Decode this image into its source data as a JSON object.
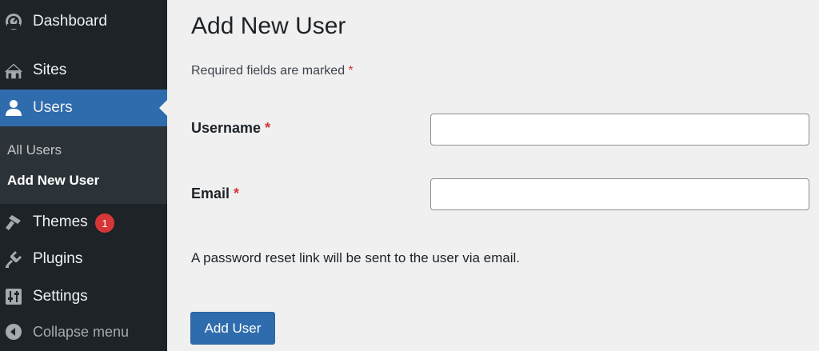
{
  "sidebar": {
    "items": [
      {
        "key": "dashboard",
        "label": "Dashboard",
        "icon": "dashboard-gauge-icon"
      },
      {
        "key": "sites",
        "label": "Sites",
        "icon": "sites-houses-icon"
      },
      {
        "key": "users",
        "label": "Users",
        "icon": "user-icon",
        "active": true
      },
      {
        "key": "themes",
        "label": "Themes",
        "icon": "brush-icon",
        "badge": "1"
      },
      {
        "key": "plugins",
        "label": "Plugins",
        "icon": "plug-icon"
      },
      {
        "key": "settings",
        "label": "Settings",
        "icon": "sliders-icon"
      },
      {
        "key": "collapse",
        "label": "Collapse menu",
        "icon": "collapse-arrow-icon"
      }
    ],
    "submenu": [
      {
        "label": "All Users"
      },
      {
        "label": "Add New User",
        "current": true
      }
    ]
  },
  "main": {
    "title": "Add New User",
    "required_note": "Required fields are marked",
    "required_marker": "*",
    "fields": [
      {
        "label": "Username",
        "value": "",
        "placeholder": ""
      },
      {
        "label": "Email",
        "value": "",
        "placeholder": ""
      }
    ],
    "password_note": "A password reset link will be sent to the user via email.",
    "submit_label": "Add User"
  },
  "colors": {
    "sidebar_bg": "#1d2327",
    "submenu_bg": "#2c3338",
    "accent": "#2f6cad",
    "badge": "#d63638",
    "required": "#d63638",
    "page_bg": "#f0f0f1"
  }
}
